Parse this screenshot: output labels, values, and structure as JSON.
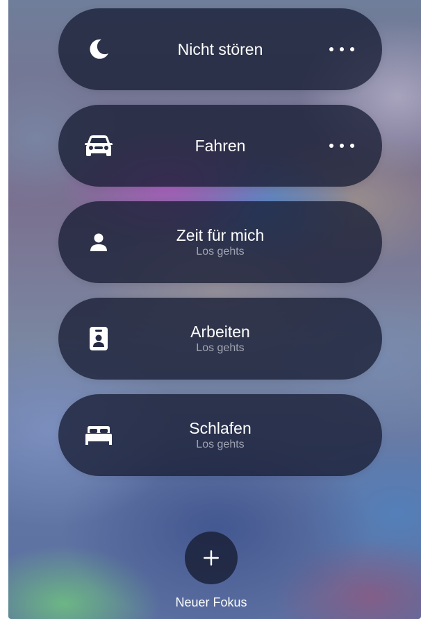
{
  "focus_modes": [
    {
      "title": "Nicht stören",
      "subtitle": "",
      "icon": "moon-icon",
      "has_more": true
    },
    {
      "title": "Fahren",
      "subtitle": "",
      "icon": "car-icon",
      "has_more": true
    },
    {
      "title": "Zeit für mich",
      "subtitle": "Los gehts",
      "icon": "person-icon",
      "has_more": false
    },
    {
      "title": "Arbeiten",
      "subtitle": "Los gehts",
      "icon": "id-badge-icon",
      "has_more": false
    },
    {
      "title": "Schlafen",
      "subtitle": "Los gehts",
      "icon": "bed-icon",
      "has_more": false
    }
  ],
  "new_focus": {
    "label": "Neuer Fokus",
    "icon": "plus-icon"
  },
  "colors": {
    "card_background": "#181e34",
    "text_primary": "#ffffff",
    "text_secondary": "#e6e8f0"
  }
}
